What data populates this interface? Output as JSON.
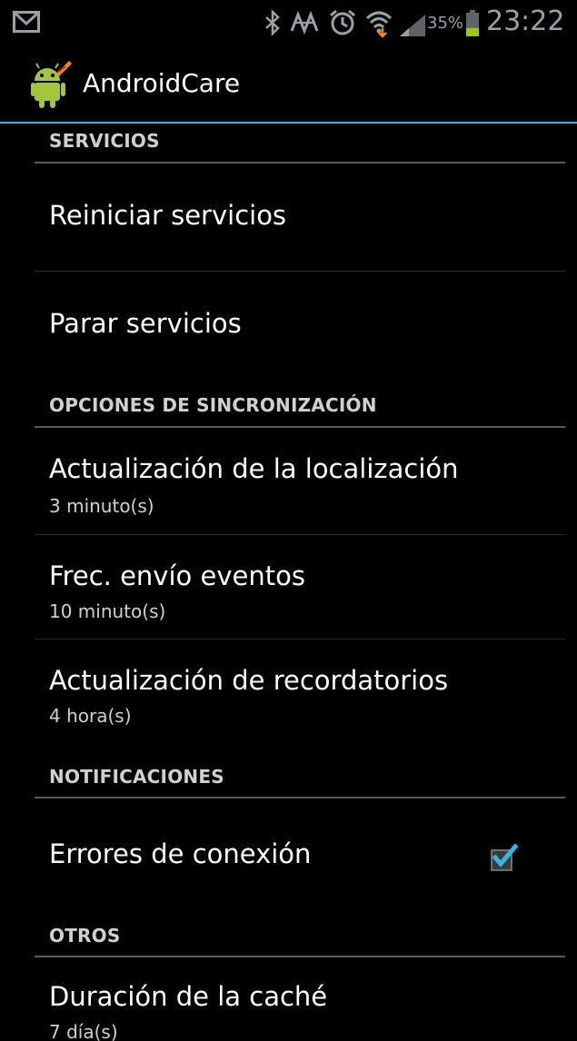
{
  "status_bar": {
    "battery_percent": "35%",
    "battery_level": 0.35,
    "time": "23:22",
    "icons": [
      "gmail-icon",
      "bluetooth-icon",
      "nfc-icon",
      "alarm-icon",
      "wifi-icon",
      "signal-icon",
      "battery-icon"
    ]
  },
  "action_bar": {
    "app_title": "AndroidCare",
    "app_icon": "android-robot-icon",
    "divider_color": "#33b5e5"
  },
  "categories": {
    "servicios": "SERVICIOS",
    "sincronizacion": "OPCIONES DE SINCRONIZACIÓN",
    "notificaciones": "NOTIFICACIONES",
    "otros": "OTROS"
  },
  "preferences": {
    "reiniciar": {
      "title": "Reiniciar servicios"
    },
    "parar": {
      "title": "Parar servicios"
    },
    "localizacion": {
      "title": "Actualización de la localización",
      "summary": "3 minuto(s)"
    },
    "eventos": {
      "title": "Frec. envío eventos",
      "summary": "10 minuto(s)"
    },
    "recordatorios": {
      "title": "Actualización de recordatorios",
      "summary": "4 hora(s)"
    },
    "errores": {
      "title": "Errores de conexión",
      "checked": true,
      "check_color": "#33b5e5"
    },
    "cache": {
      "title": "Duración de la caché",
      "summary": "7 día(s)"
    }
  }
}
